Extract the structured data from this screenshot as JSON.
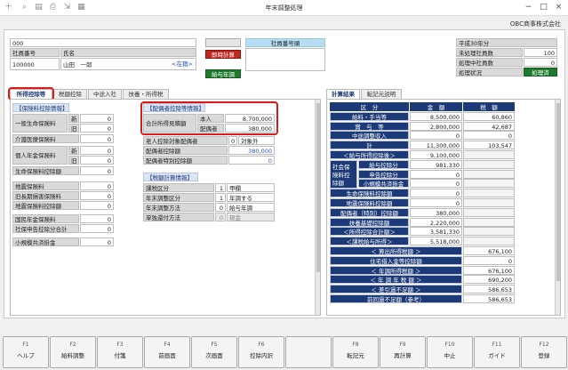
{
  "window": {
    "title": "年末調整処理"
  },
  "company": "OBC商事株式会社",
  "header": {
    "code_top": "000",
    "emp_code_label": "社員番号",
    "emp_code": "100000",
    "emp_name_label": "氏名",
    "emp_name": "山田　一郎",
    "status_link": "<在籍>",
    "sokuji_btn": "即時計算",
    "kyuyo_btn": "給与年調",
    "shain_bangou_hdr": "社員番号順",
    "year_label": "平成30年分",
    "unproc_label": "未処理社員数",
    "unproc_val": "100",
    "proc_label": "処理中社員数",
    "proc_val": "0",
    "status_label": "処理状況",
    "status_val": "処理済"
  },
  "left_tabs": [
    "所得控除等",
    "税額控除",
    "中途入社",
    "扶養・所得税"
  ],
  "right_tabs": [
    "計算結果",
    "転記元説明"
  ],
  "insurance": {
    "title": "【保険料控除情報】",
    "rows": [
      {
        "label": "一般生命保険料",
        "sub": "新",
        "val": "0"
      },
      {
        "label": "",
        "sub": "旧",
        "val": "0"
      },
      {
        "label": "介護医療保険料",
        "sub": "",
        "val": "0"
      },
      {
        "label": "個人年金保険料",
        "sub": "新",
        "val": "0"
      },
      {
        "label": "",
        "sub": "旧",
        "val": "0"
      },
      {
        "label": "生命保険料控除額",
        "sub": "",
        "val": "0"
      },
      {
        "label": "地震保険料",
        "sub": "",
        "val": "0"
      },
      {
        "label": "旧長期損害保険料",
        "sub": "",
        "val": "0"
      },
      {
        "label": "地震保険料控除額",
        "sub": "",
        "val": "0"
      },
      {
        "label": "国民年金保険料",
        "sub": "",
        "val": "0"
      },
      {
        "label": "社保申告控除分合計",
        "sub": "",
        "val": "0"
      },
      {
        "label": "小規模共済掛金",
        "sub": "",
        "val": "0"
      }
    ]
  },
  "spouse": {
    "title": "【配偶者控除等情報】",
    "total_label": "合計所得見積額",
    "honnin_label": "本人",
    "honnin_val": "8,700,000",
    "haigu_label": "配偶者",
    "haigu_val": "380,000",
    "rows": [
      {
        "label": "老人控除対象配偶者",
        "code": "0",
        "val": "対象外"
      },
      {
        "label": "配偶者控除額",
        "code": "",
        "val": "380,000"
      },
      {
        "label": "配偶者特別控除額",
        "code": "",
        "val": "0"
      }
    ]
  },
  "tax": {
    "title": "【税額計算情報】",
    "rows": [
      {
        "label": "課税区分",
        "code": "1",
        "val": "甲欄"
      },
      {
        "label": "年末調整区分",
        "code": "1",
        "val": "年調する"
      },
      {
        "label": "年末調整方法",
        "code": "0",
        "val": "給与年調"
      },
      {
        "label": "単独還付方法",
        "code": "0",
        "val": "現金"
      }
    ]
  },
  "result": {
    "hdr": [
      "区　分",
      "金　額",
      "税　額"
    ],
    "rows": [
      {
        "label": "給料・手当等",
        "amt": "8,500,000",
        "tax": "60,860"
      },
      {
        "label": "賞　与　等",
        "amt": "2,800,000",
        "tax": "42,687"
      },
      {
        "label": "中途調整収入",
        "amt": "0",
        "tax": "0"
      },
      {
        "label": "計",
        "amt": "11,300,000",
        "tax": "103,547"
      },
      {
        "label": "＜給与所得控除後＞",
        "amt": "9,100,000",
        "tax": ""
      },
      {
        "label": "給与控除分",
        "amt": "981,330",
        "tax": ""
      },
      {
        "label": "申告控除分",
        "amt": "0",
        "tax": ""
      },
      {
        "label": "小規模共済掛金",
        "amt": "0",
        "tax": ""
      },
      {
        "label": "生命保険料控除額",
        "amt": "0",
        "tax": ""
      },
      {
        "label": "地震保険料控除額",
        "amt": "0",
        "tax": ""
      },
      {
        "label": "配偶者（特別）控除額",
        "amt": "380,000",
        "tax": ""
      },
      {
        "label": "扶養基礎控除額",
        "amt": "2,220,000",
        "tax": ""
      },
      {
        "label": "＜所得控除合計額＞",
        "amt": "3,581,330",
        "tax": ""
      },
      {
        "label": "＜課税給与所得＞",
        "amt": "5,518,000",
        "tax": ""
      },
      {
        "label": "＜ 算出所得税額 ＞",
        "amt": "",
        "tax": "676,100"
      },
      {
        "label": "住宅借入金等控除額",
        "amt": "",
        "tax": "0"
      },
      {
        "label": "＜ 年調所得税額 ＞",
        "amt": "",
        "tax": "676,100"
      },
      {
        "label": "＜ 年 調 年 税 額 ＞",
        "amt": "",
        "tax": "690,200"
      },
      {
        "label": "＜ 差引過不足額 ＞",
        "amt": "",
        "tax": "586,653"
      },
      {
        "label": "前回過不足額（参考）",
        "amt": "",
        "tax": "586,653"
      }
    ],
    "shakai_label": "社会保険料控除額"
  },
  "fkeys": [
    {
      "k": "F1",
      "l": "ヘルプ"
    },
    {
      "k": "F2",
      "l": "給料調整"
    },
    {
      "k": "F3",
      "l": "付箋"
    },
    {
      "k": "F4",
      "l": "前画面"
    },
    {
      "k": "F5",
      "l": "次画面"
    },
    {
      "k": "F6",
      "l": "控除内訳"
    },
    {
      "k": "",
      "l": ""
    },
    {
      "k": "F8",
      "l": "転記元"
    },
    {
      "k": "F9",
      "l": "再計算"
    },
    {
      "k": "F10",
      "l": "中止"
    },
    {
      "k": "F11",
      "l": "ガイド"
    },
    {
      "k": "F12",
      "l": "登録"
    }
  ]
}
